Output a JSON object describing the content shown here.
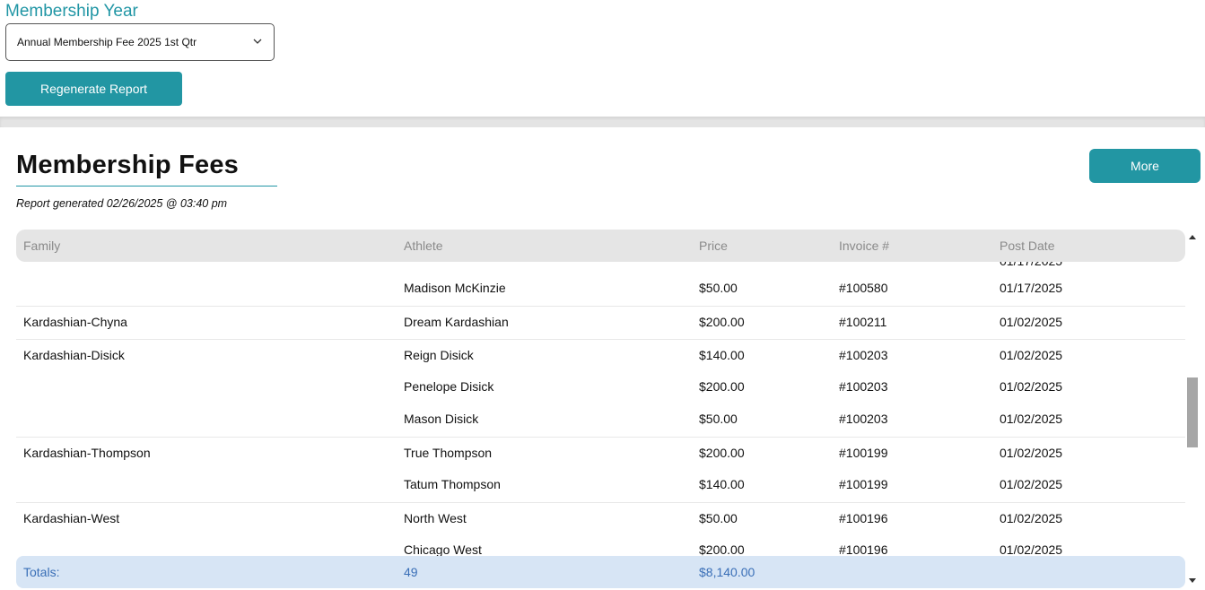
{
  "filters": {
    "label": "Membership Year",
    "selected": "Annual Membership Fee 2025 1st Qtr",
    "regenerate_label": "Regenerate Report"
  },
  "report": {
    "title": "Membership Fees",
    "generated": "Report generated 02/26/2025 @ 03:40 pm",
    "more_label": "More"
  },
  "table": {
    "headers": [
      "Family",
      "Athlete",
      "Price",
      "Invoice #",
      "Post Date"
    ],
    "rows": [
      {
        "family": "",
        "athlete": "Madison McKinzie",
        "price": "$50.00",
        "invoice": "#100580",
        "date": "01/17/2025"
      },
      {
        "family": "Kardashian-Chyna",
        "athlete": "Dream Kardashian",
        "price": "$200.00",
        "invoice": "#100211",
        "date": "01/02/2025"
      },
      {
        "family": "Kardashian-Disick",
        "athlete": "Reign Disick",
        "price": "$140.00",
        "invoice": "#100203",
        "date": "01/02/2025"
      },
      {
        "family": "",
        "athlete": "Penelope Disick",
        "price": "$200.00",
        "invoice": "#100203",
        "date": "01/02/2025"
      },
      {
        "family": "",
        "athlete": "Mason Disick",
        "price": "$50.00",
        "invoice": "#100203",
        "date": "01/02/2025"
      },
      {
        "family": "Kardashian-Thompson",
        "athlete": "True Thompson",
        "price": "$200.00",
        "invoice": "#100199",
        "date": "01/02/2025"
      },
      {
        "family": "",
        "athlete": "Tatum Thompson",
        "price": "$140.00",
        "invoice": "#100199",
        "date": "01/02/2025"
      },
      {
        "family": "Kardashian-West",
        "athlete": "North West",
        "price": "$50.00",
        "invoice": "#100196",
        "date": "01/02/2025"
      },
      {
        "family": "",
        "athlete": "Chicago West",
        "price": "$200.00",
        "invoice": "#100196",
        "date": "01/02/2025"
      }
    ],
    "totals": {
      "label": "Totals:",
      "count": "49",
      "amount": "$8,140.00"
    }
  },
  "icons": {
    "select_chevron": "chevron-down-icon",
    "scroll_up": "arrow-up-icon",
    "scroll_down": "arrow-down-icon"
  },
  "colors": {
    "accent": "#2296a3",
    "totals_bg": "#d7e5f5",
    "totals_text": "#3a6fb7"
  }
}
